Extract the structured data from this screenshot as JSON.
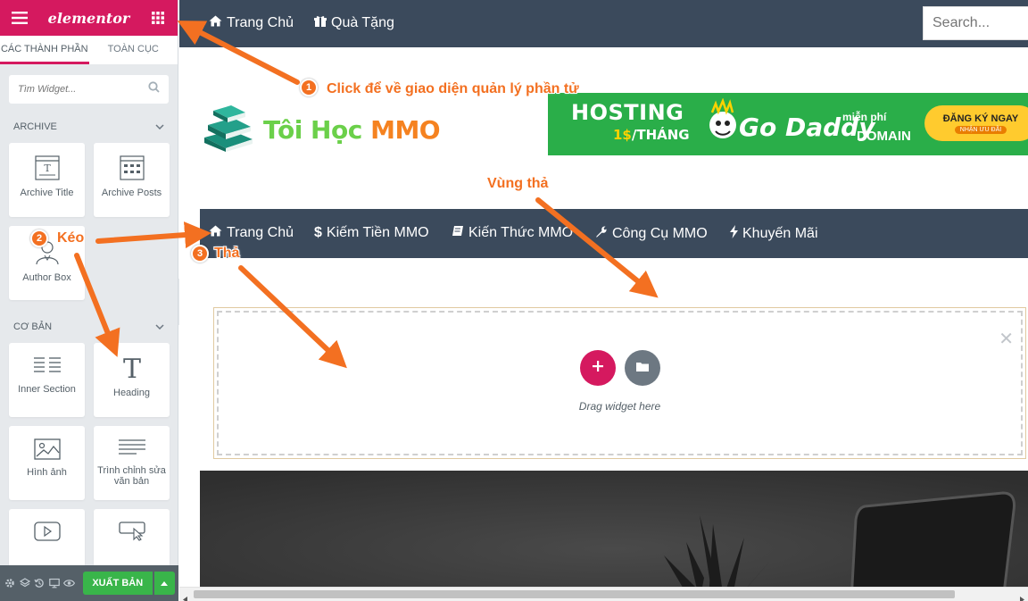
{
  "sidebar": {
    "logo": "elementor",
    "tabs": [
      {
        "label": "CÁC THÀNH PHẦN",
        "active": true
      },
      {
        "label": "TOÀN CỤC",
        "active": false
      }
    ],
    "search_placeholder": "Tìm Widget...",
    "categories": [
      {
        "label": "ARCHIVE",
        "widgets": [
          {
            "label": "Archive Title",
            "icon": "archive-title-icon"
          },
          {
            "label": "Archive Posts",
            "icon": "archive-posts-icon"
          },
          {
            "label": "Author Box",
            "icon": "author-box-icon"
          }
        ]
      },
      {
        "label": "CƠ BẢN",
        "widgets": [
          {
            "label": "Inner Section",
            "icon": "inner-section-icon"
          },
          {
            "label": "Heading",
            "icon": "heading-icon"
          },
          {
            "label": "Hình ảnh",
            "icon": "image-icon"
          },
          {
            "label": "Trình chỉnh sửa văn bản",
            "icon": "text-editor-icon"
          },
          {
            "label": "",
            "icon": "video-icon"
          },
          {
            "label": "",
            "icon": "button-icon"
          }
        ]
      }
    ],
    "publish_label": "XUẤT BẢN",
    "accent_color": "#d5195f",
    "publish_color": "#39b54a"
  },
  "preview": {
    "top_nav": [
      {
        "label": "Trang Chủ",
        "icon": "home-icon"
      },
      {
        "label": "Quà Tặng",
        "icon": "gift-icon"
      }
    ],
    "search_placeholder": "Search...",
    "logo": {
      "part1": "Tôi Học",
      "part2": "MMO"
    },
    "banner": {
      "hosting": "HOSTING",
      "price_prefix": "1$",
      "price_suffix": "/THÁNG",
      "brand": "Go Daddy",
      "free": "miễn phí",
      "domain": "DOMAIN",
      "cta": "ĐĂNG KÝ NGAY",
      "cta_sub": "NHẬN ƯU ĐÃI"
    },
    "main_nav": [
      {
        "label": "Trang Chủ",
        "icon": "home-icon"
      },
      {
        "label": "Kiếm Tiền MMO",
        "icon": "dollar-icon"
      },
      {
        "label": "Kiến Thức MMO",
        "icon": "book-icon"
      },
      {
        "label": "Công Cụ MMO",
        "icon": "wrench-icon"
      },
      {
        "label": "Khuyến Mãi",
        "icon": "bolt-icon"
      }
    ],
    "drop_text": "Drag widget here",
    "nav_color": "#3b4a5c"
  },
  "annotations": {
    "step1": {
      "num": "1",
      "text": "Click để về giao diện quản lý phần tử"
    },
    "step2": {
      "num": "2",
      "text": "Kéo"
    },
    "step3": {
      "num": "3",
      "text": "Thả"
    },
    "drop_zone_label": "Vùng thả",
    "color": "#f37021"
  }
}
